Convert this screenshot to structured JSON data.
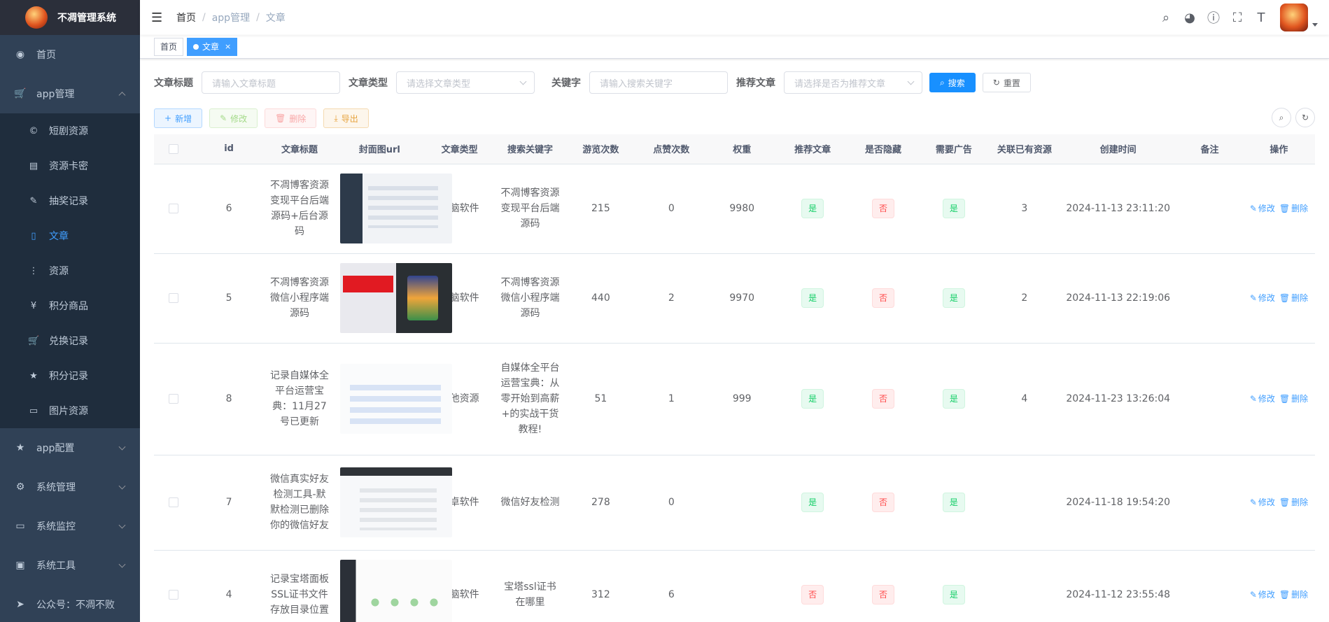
{
  "app": {
    "title": "不凋管理系统"
  },
  "sidebar": {
    "items": [
      {
        "label": "首页",
        "icon": "dashboard-icon"
      },
      {
        "label": "app管理",
        "icon": "cart-icon",
        "expanded": true,
        "children": [
          {
            "label": "短剧资源",
            "icon": "copyright-icon"
          },
          {
            "label": "资源卡密",
            "icon": "store-icon"
          },
          {
            "label": "抽奖记录",
            "icon": "edit-doc-icon"
          },
          {
            "label": "文章",
            "icon": "book-icon",
            "active": true
          },
          {
            "label": "资源",
            "icon": "tree-icon"
          },
          {
            "label": "积分商品",
            "icon": "yen-icon"
          },
          {
            "label": "兑换记录",
            "icon": "cart-icon"
          },
          {
            "label": "积分记录",
            "icon": "star-icon"
          },
          {
            "label": "图片资源",
            "icon": "monitor-icon"
          }
        ]
      },
      {
        "label": "app配置",
        "icon": "star-icon"
      },
      {
        "label": "系统管理",
        "icon": "gear-icon"
      },
      {
        "label": "系统监控",
        "icon": "monitor-icon"
      },
      {
        "label": "系统工具",
        "icon": "toolbox-icon"
      },
      {
        "label": "公众号：不凋不败",
        "icon": "send-icon"
      }
    ]
  },
  "navbar": {
    "breadcrumb": [
      "首页",
      "app管理",
      "文章"
    ],
    "icons": [
      "search-icon",
      "github-icon",
      "help-icon",
      "fullscreen-icon",
      "font-size-icon"
    ]
  },
  "tags": [
    {
      "label": "首页"
    },
    {
      "label": "文章",
      "active": true
    }
  ],
  "search": {
    "title_label": "文章标题",
    "title_placeholder": "请输入文章标题",
    "type_label": "文章类型",
    "type_placeholder": "请选择文章类型",
    "keyword_label": "关键字",
    "keyword_placeholder": "请输入搜索关键字",
    "recommend_label": "推荐文章",
    "recommend_placeholder": "请选择是否为推荐文章",
    "search_button": "搜索",
    "reset_button": "重置"
  },
  "toolbar": {
    "add": "新增",
    "edit": "修改",
    "delete": "删除",
    "export": "导出"
  },
  "table": {
    "columns": [
      "id",
      "文章标题",
      "封面图url",
      "文章类型",
      "搜索关键字",
      "游览次数",
      "点赞次数",
      "权重",
      "推荐文章",
      "是否隐藏",
      "需要广告",
      "关联已有资源",
      "创建时间",
      "备注",
      "操作"
    ],
    "actions": {
      "edit": "修改",
      "delete": "删除"
    },
    "rows": [
      {
        "id": "6",
        "title": "不凋博客资源变现平台后端源码+后台源码",
        "type": "电脑软件",
        "keyword": "不凋博客资源变现平台后端源码",
        "views": "215",
        "likes": "0",
        "weight": "9980",
        "recommend": "是",
        "hidden": "否",
        "ad": "是",
        "related": "3",
        "created": "2024-11-13 23:11:20",
        "remark": ""
      },
      {
        "id": "5",
        "title": "不凋博客资源微信小程序端源码",
        "type": "电脑软件",
        "keyword": "不凋博客资源微信小程序端源码",
        "views": "440",
        "likes": "2",
        "weight": "9970",
        "recommend": "是",
        "hidden": "否",
        "ad": "是",
        "related": "2",
        "created": "2024-11-13 22:19:06",
        "remark": ""
      },
      {
        "id": "8",
        "title": "记录自媒体全平台运营宝典：11月27号已更新",
        "type": "其他资源",
        "keyword": "自媒体全平台运营宝典：从零开始到高薪+的实战干货教程!",
        "views": "51",
        "likes": "1",
        "weight": "999",
        "recommend": "是",
        "hidden": "否",
        "ad": "是",
        "related": "4",
        "created": "2024-11-23 13:26:04",
        "remark": ""
      },
      {
        "id": "7",
        "title": "微信真实好友检测工具-默默检测已删除你的微信好友",
        "type": "安卓软件",
        "keyword": "微信好友检测",
        "views": "278",
        "likes": "0",
        "weight": "",
        "recommend": "是",
        "hidden": "否",
        "ad": "是",
        "related": "",
        "created": "2024-11-18 19:54:20",
        "remark": ""
      },
      {
        "id": "4",
        "title": "记录宝塔面板SSL证书文件存放目录位置",
        "type": "电脑软件",
        "keyword": "宝塔ssl证书在哪里",
        "views": "312",
        "likes": "6",
        "weight": "",
        "recommend": "否",
        "hidden": "否",
        "ad": "是",
        "related": "",
        "created": "2024-11-12 23:55:48",
        "remark": ""
      }
    ]
  },
  "colors": {
    "sidebar_bg": "#304156",
    "accent": "#409eff",
    "success": "#13ce66",
    "danger": "#ff4949"
  }
}
